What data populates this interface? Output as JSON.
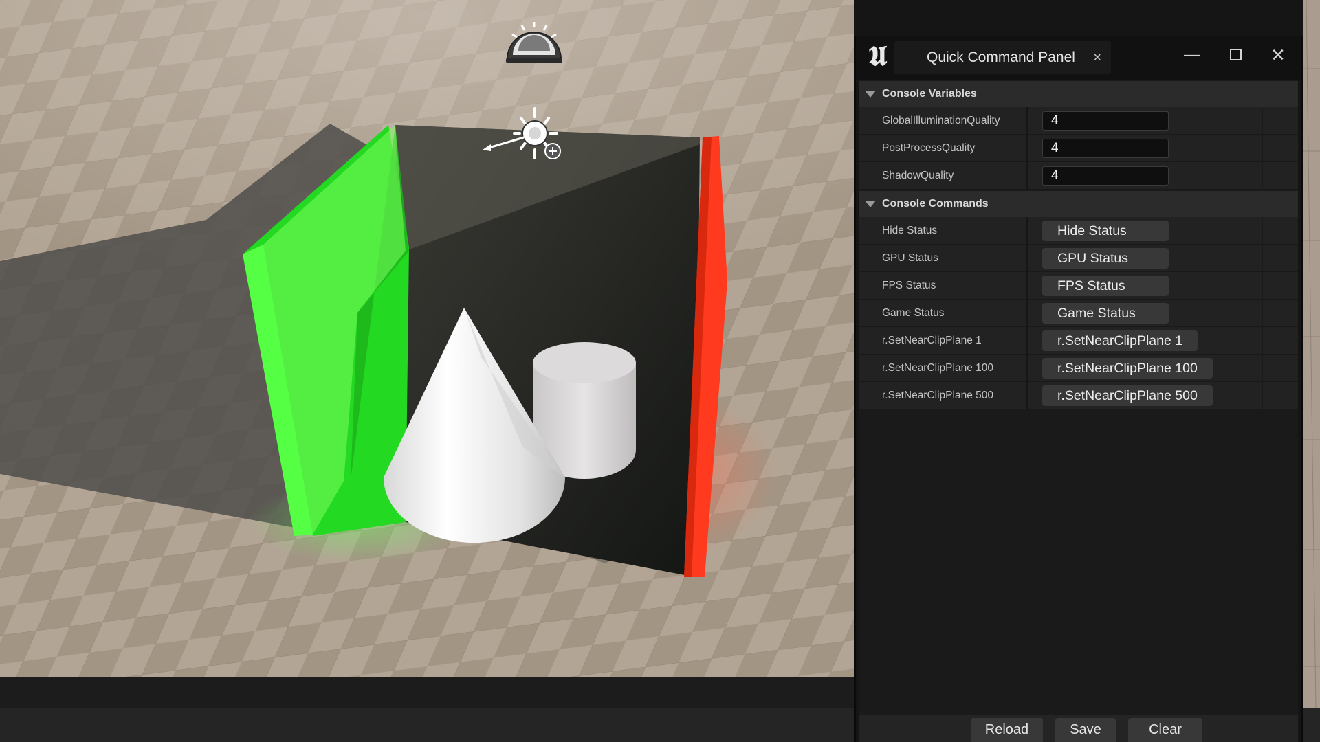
{
  "window": {
    "title": "Quick Command Panel",
    "tab_close": "×",
    "minimize": "—",
    "close": "✕"
  },
  "sections": {
    "variables": {
      "label": "Console Variables"
    },
    "commands": {
      "label": "Console Commands"
    }
  },
  "variables": [
    {
      "name": "GlobalIlluminationQuality",
      "value": "4"
    },
    {
      "name": "PostProcessQuality",
      "value": "4"
    },
    {
      "name": "ShadowQuality",
      "value": "4"
    }
  ],
  "commands": [
    {
      "name": "Hide Status",
      "button": "Hide Status"
    },
    {
      "name": "GPU Status",
      "button": "GPU Status"
    },
    {
      "name": "FPS Status",
      "button": "FPS Status"
    },
    {
      "name": "Game Status",
      "button": "Game Status"
    },
    {
      "name": "r.SetNearClipPlane 1",
      "button": "r.SetNearClipPlane 1"
    },
    {
      "name": "r.SetNearClipPlane 100",
      "button": "r.SetNearClipPlane 100"
    },
    {
      "name": "r.SetNearClipPlane 500",
      "button": "r.SetNearClipPlane 500"
    }
  ],
  "footer": {
    "reload": "Reload",
    "save": "Save",
    "clear": "Clear"
  },
  "icons": {
    "engine_logo": "unreal-logo",
    "sky_light": "sky-light-icon",
    "directional_light": "directional-light-icon"
  },
  "colors": {
    "green_wall": "#3df53a",
    "red_wall": "#ff3b22",
    "floor": "#a8998a"
  }
}
